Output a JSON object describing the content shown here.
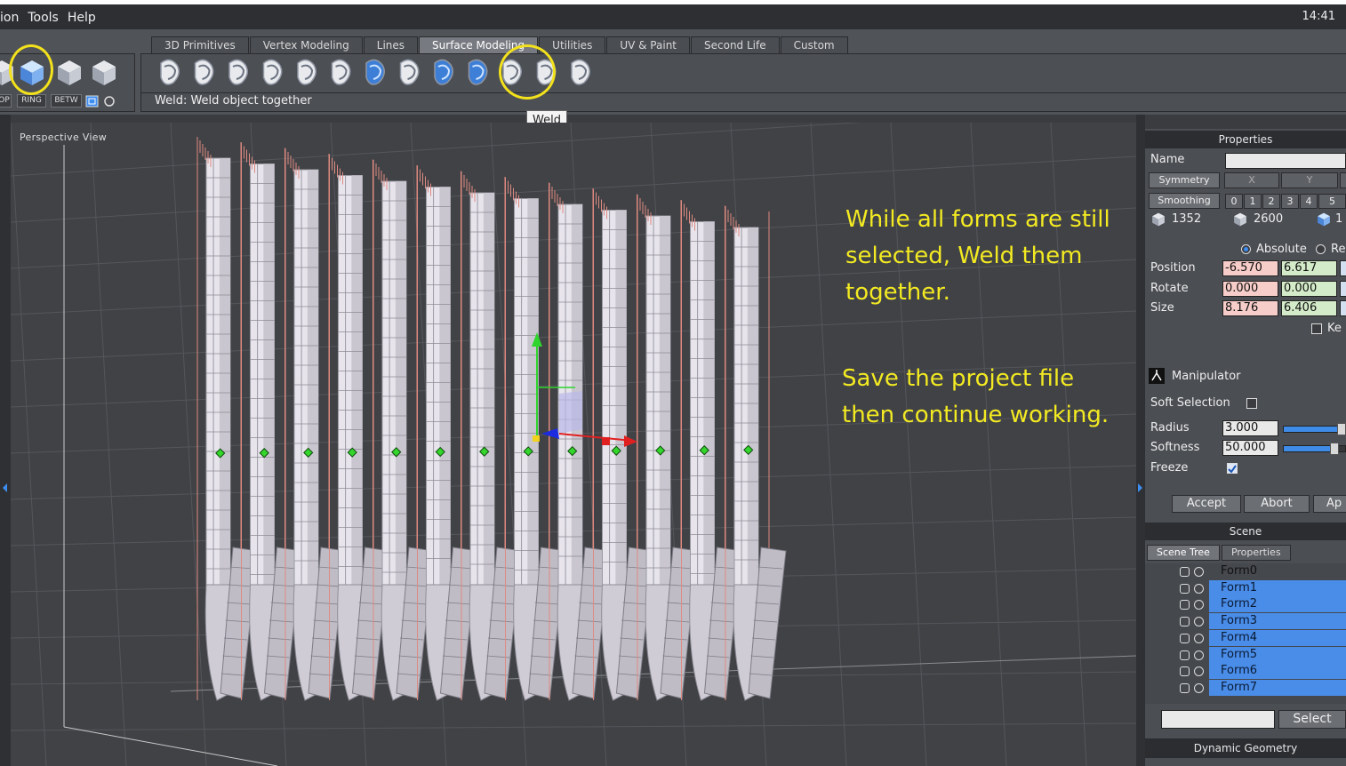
{
  "menu": {
    "items": [
      "ion",
      "Tools",
      "Help"
    ],
    "clock": "14:41"
  },
  "toolbar": {
    "tabs": [
      "3D Primitives",
      "Vertex Modeling",
      "Lines",
      "Surface Modeling",
      "Utilities",
      "UV & Paint",
      "Second Life",
      "Custom"
    ],
    "active_tab": "Surface Modeling",
    "status_text": "Weld: Weld object together",
    "tooltip": "Weld",
    "small_buttons": [
      "OP",
      "RING",
      "BETW"
    ]
  },
  "viewport": {
    "label": "Perspective View",
    "annotation_1": [
      "While all forms are still",
      "selected, Weld them",
      "together."
    ],
    "annotation_2": [
      "Save the project file",
      "then continue working."
    ]
  },
  "properties": {
    "header": "Properties",
    "name_label": "Name",
    "name_value": "",
    "symmetry_label": "Symmetry",
    "axes": [
      "X",
      "Y"
    ],
    "smoothing_label": "Smoothing",
    "smoothing_levels": [
      "0",
      "1",
      "2",
      "3",
      "4",
      "5"
    ],
    "counts": [
      "1352",
      "2600",
      "1"
    ],
    "absolute_label": "Absolute",
    "relative_label": "Re",
    "position_label": "Position",
    "rotate_label": "Rotate",
    "size_label": "Size",
    "position": [
      "-6.570",
      "6.617"
    ],
    "rotate": [
      "0.000",
      "0.000"
    ],
    "size": [
      "8.176",
      "6.406"
    ],
    "keep_label": "Ke",
    "manipulator_label": "Manipulator",
    "soft_selection_label": "Soft Selection",
    "radius_label": "Radius",
    "radius_value": "3.000",
    "softness_label": "Softness",
    "softness_value": "50.000",
    "freeze_label": "Freeze",
    "accept_label": "Accept",
    "abort_label": "Abort",
    "apply_label": "Ap"
  },
  "scene": {
    "header": "Scene",
    "tabs": [
      "Scene Tree",
      "Properties"
    ],
    "items": [
      {
        "name": "Form0",
        "selected": false
      },
      {
        "name": "Form1",
        "selected": true
      },
      {
        "name": "Form2",
        "selected": true
      },
      {
        "name": "Form3",
        "selected": true
      },
      {
        "name": "Form4",
        "selected": true
      },
      {
        "name": "Form5",
        "selected": true
      },
      {
        "name": "Form6",
        "selected": true
      },
      {
        "name": "Form7",
        "selected": true
      }
    ],
    "search_value": "",
    "select_label": "Select",
    "dynamic_geometry_header": "Dynamic Geometry"
  },
  "colors": {
    "annotation": "#f3ea22",
    "highlight_circle": "#f2e11c",
    "selection": "#4a8de8"
  }
}
